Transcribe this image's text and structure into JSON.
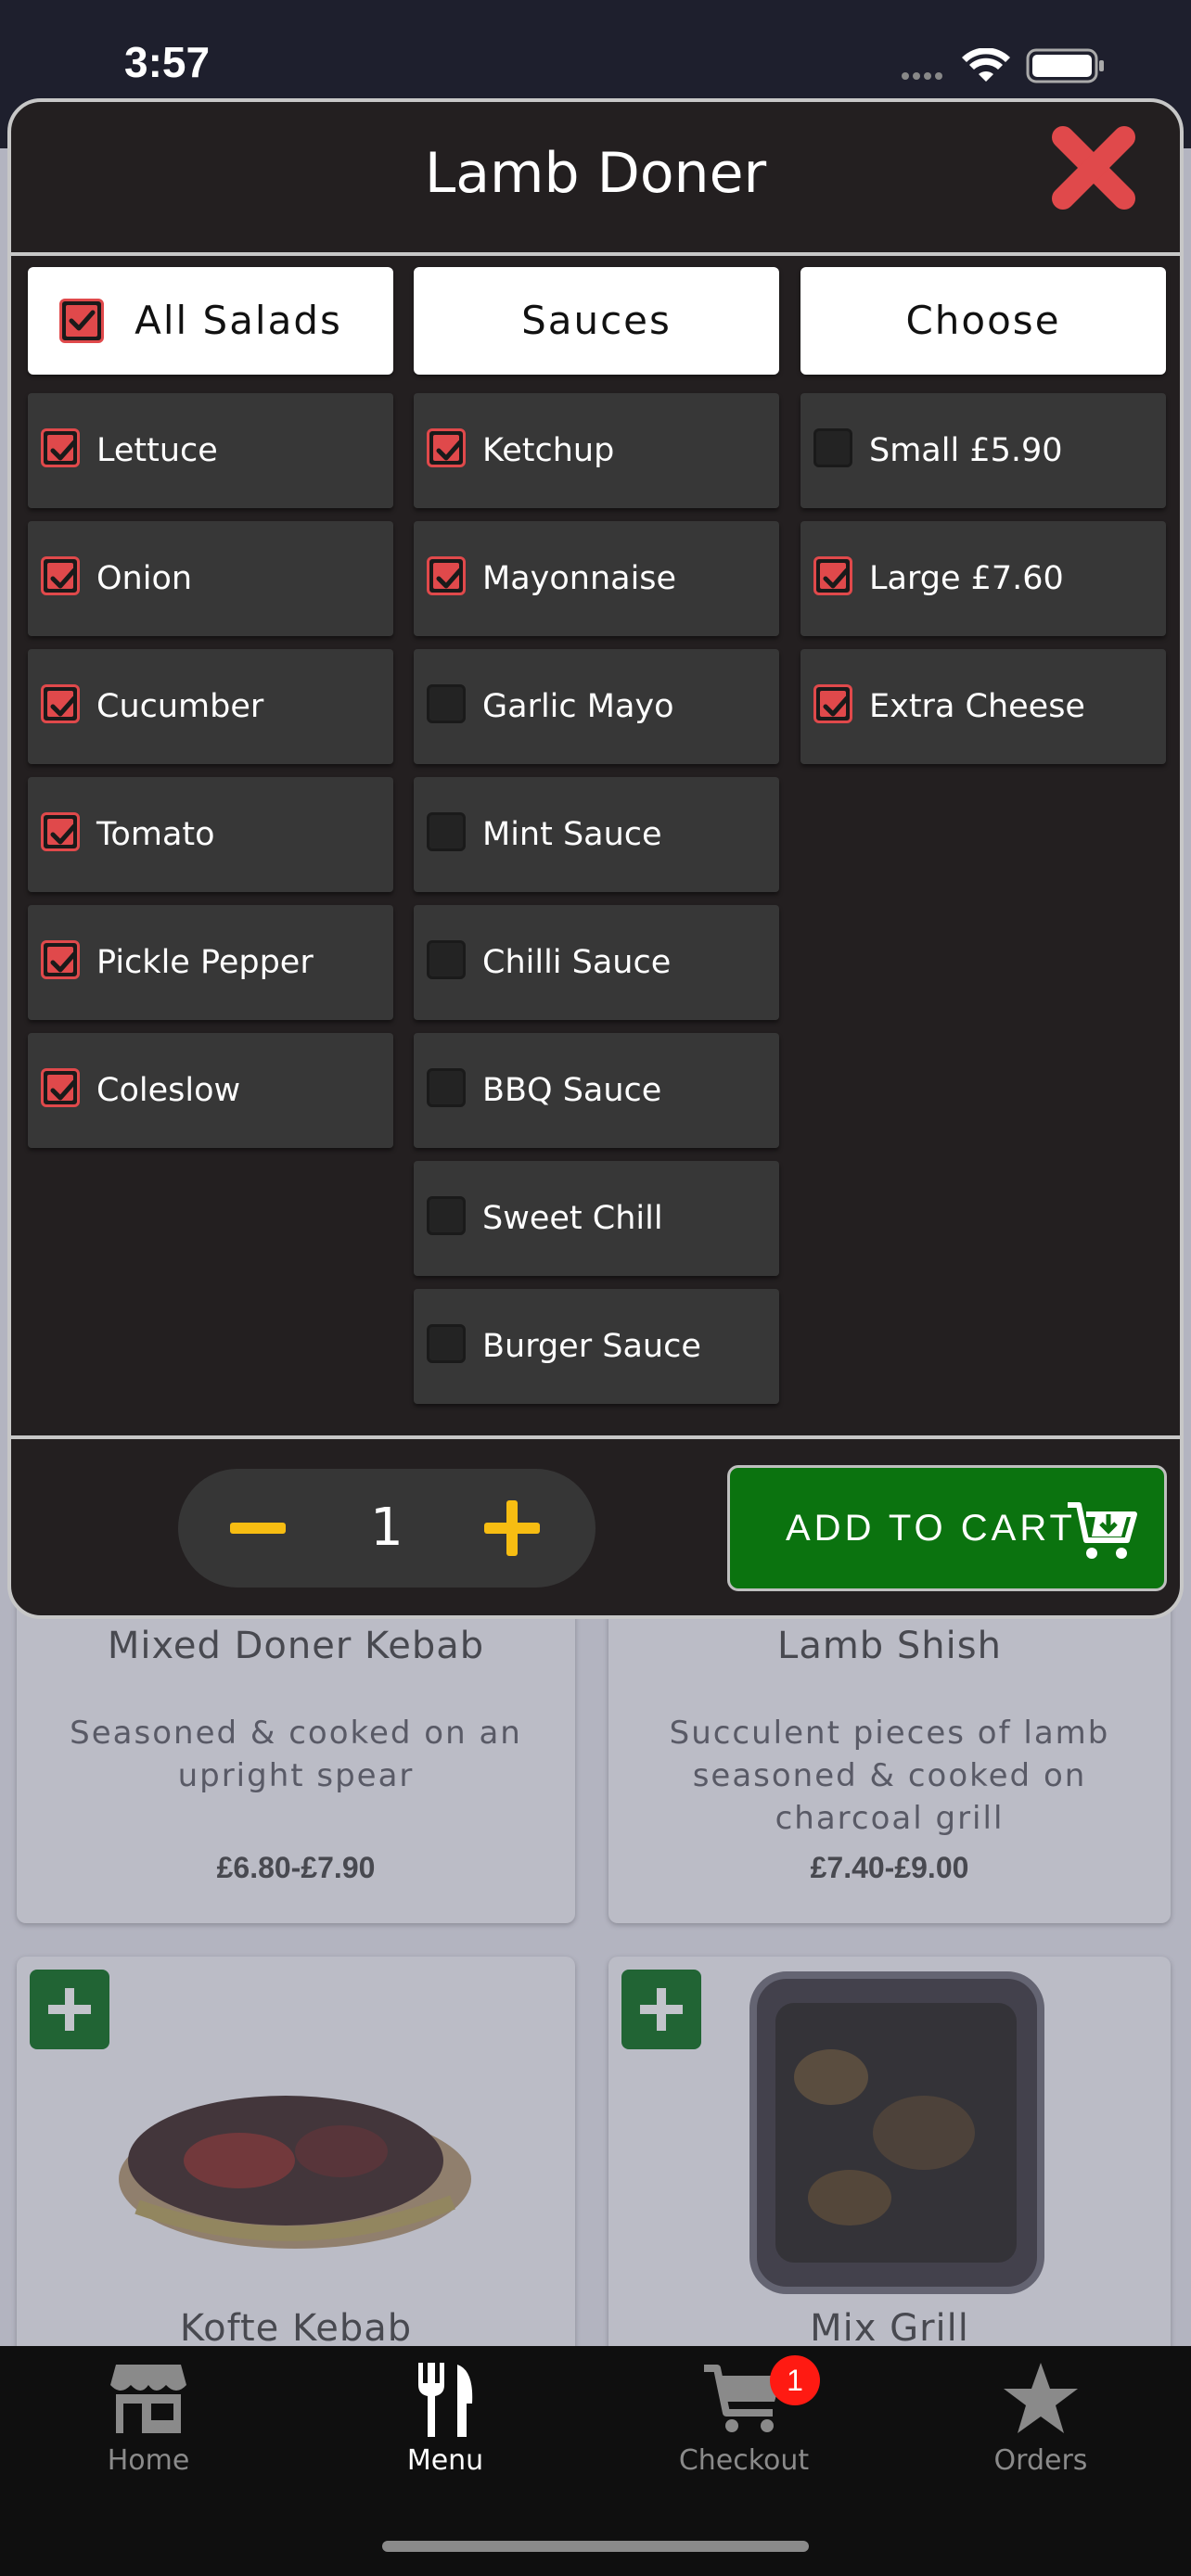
{
  "status_bar": {
    "time": "3:57"
  },
  "modal": {
    "title": "Lamb Doner",
    "columns": [
      {
        "header": "All Salads",
        "header_checked": true,
        "items": [
          {
            "label": "Lettuce",
            "checked": true
          },
          {
            "label": "Onion",
            "checked": true
          },
          {
            "label": "Cucumber",
            "checked": true
          },
          {
            "label": "Tomato",
            "checked": true
          },
          {
            "label": "Pickle Pepper",
            "checked": true
          },
          {
            "label": "Coleslow",
            "checked": true
          }
        ]
      },
      {
        "header": "Sauces",
        "items": [
          {
            "label": "Ketchup",
            "checked": true
          },
          {
            "label": "Mayonnaise",
            "checked": true
          },
          {
            "label": "Garlic Mayo",
            "checked": false
          },
          {
            "label": "Mint Sauce",
            "checked": false
          },
          {
            "label": "Chilli Sauce",
            "checked": false
          },
          {
            "label": "BBQ Sauce",
            "checked": false
          },
          {
            "label": "Sweet Chill",
            "checked": false
          },
          {
            "label": "Burger Sauce",
            "checked": false
          }
        ]
      },
      {
        "header": "Choose",
        "items": [
          {
            "label": "Small £5.90",
            "checked": false
          },
          {
            "label": "Large £7.60",
            "checked": true
          },
          {
            "label": "Extra Cheese",
            "checked": true
          }
        ]
      }
    ],
    "quantity": "1",
    "add_to_cart_label": "ADD TO CART"
  },
  "background_menu": {
    "items": [
      {
        "title": "Mixed Doner Kebab",
        "description": "Seasoned & cooked on an upright spear",
        "price": "£6.80-£7.90"
      },
      {
        "title": "Lamb Shish",
        "description": "Succulent pieces of lamb seasoned & cooked on charcoal grill",
        "price": "£7.40-£9.00"
      },
      {
        "title": "Kofte Kebab"
      },
      {
        "title": "Mix Grill"
      }
    ]
  },
  "tab_bar": {
    "tabs": [
      {
        "label": "Home",
        "icon": "store-icon",
        "active": false
      },
      {
        "label": "Menu",
        "icon": "fork-knife-icon",
        "active": true
      },
      {
        "label": "Checkout",
        "icon": "cart-icon",
        "active": false,
        "badge": "1"
      },
      {
        "label": "Orders",
        "icon": "star-icon",
        "active": false
      }
    ]
  },
  "colors": {
    "accent_red": "#e0494b",
    "add_to_cart_green": "#0b730f",
    "stepper_yellow": "#f7bd12",
    "badge_red": "#ff1a12"
  }
}
